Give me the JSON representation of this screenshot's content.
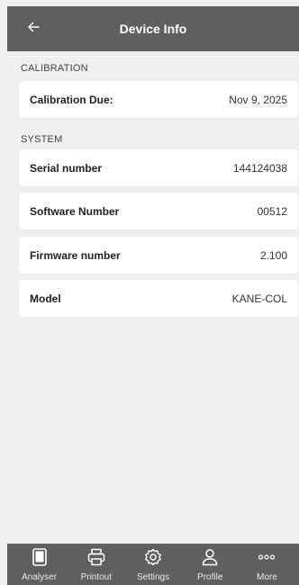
{
  "header": {
    "title": "Device Info",
    "back_icon": "arrow-left-icon"
  },
  "sections": {
    "calibration": {
      "label": "CALIBRATION",
      "rows": [
        {
          "label": "Calibration Due:",
          "value": "Nov 9, 2025"
        }
      ]
    },
    "system": {
      "label": "SYSTEM",
      "rows": [
        {
          "label": "Serial number",
          "value": "144124038"
        },
        {
          "label": "Software Number",
          "value": "00512"
        },
        {
          "label": "Firmware number",
          "value": "2.100"
        },
        {
          "label": "Model",
          "value": "KANE-COL"
        }
      ]
    }
  },
  "tabbar": {
    "items": [
      {
        "label": "Analyser",
        "icon": "analyser-icon"
      },
      {
        "label": "Printout",
        "icon": "printer-icon"
      },
      {
        "label": "Settings",
        "icon": "gear-icon"
      },
      {
        "label": "Profile",
        "icon": "user-icon"
      },
      {
        "label": "More",
        "icon": "more-icon"
      }
    ]
  },
  "colors": {
    "header_bg": "#5f5f5f",
    "page_bg": "#efefef",
    "card_bg": "#ffffff"
  }
}
